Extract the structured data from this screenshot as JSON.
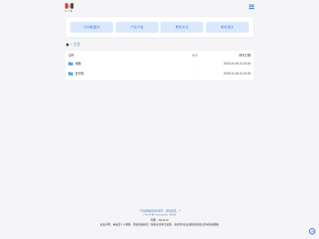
{
  "header": {
    "logo_text": "豆 丁 猫"
  },
  "nav": {
    "buttons": [
      {
        "label": "打印和复印"
      },
      {
        "label": "产品介绍"
      },
      {
        "label": "联系中文"
      },
      {
        "label": "联系英文"
      }
    ]
  },
  "breadcrumb": {
    "label": "主页"
  },
  "table": {
    "headers": {
      "name": "名称",
      "size": "大小",
      "date": "修改日期"
    },
    "rows": [
      {
        "name": "电脑",
        "size": "-",
        "date": "2025-10-06 21:20:34"
      },
      {
        "name": "复印机",
        "size": "-",
        "date": "2025-10-06 12:20:26"
      }
    ]
  },
  "footer": {
    "line1_prefix": "*",
    "line1_main": "可在网站搜索关键字，搜索资源。",
    "line1_suffix": "*",
    "line2": "© 2025 豆丁猫 · Powered by ZFile · 技术支持",
    "line3": "管理：OpenList",
    "line4": "免责声明：本站仅个人网盘，所提供资料仅一些供交流学习使用，请勿作为商业或非法用途(该内容请删除)"
  },
  "colors": {
    "accent": "#3a7bd5",
    "nav_button_bg": "#dbe8fb",
    "background": "#f5f5f7"
  },
  "icons": {
    "logo": "dog-logo",
    "menu": "menu-icon",
    "breadcrumb_home": "home-icon",
    "folder": "folder-icon",
    "scroll_top": "chevron-up-icon"
  }
}
